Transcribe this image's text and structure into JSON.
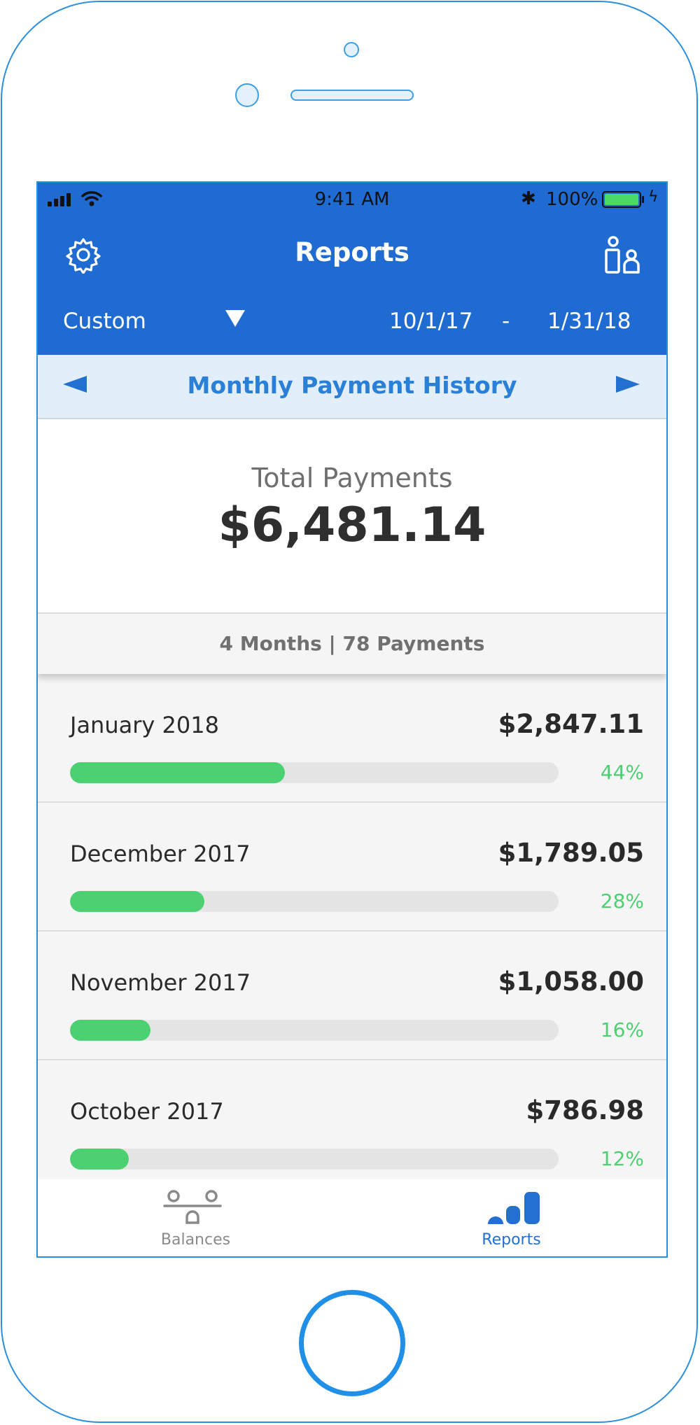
{
  "status_bar": {
    "time": "9:41 AM",
    "battery": "100%"
  },
  "header": {
    "title": "Reports",
    "settings_icon": "gear-icon",
    "profile_icon": "people-icon"
  },
  "date_range": {
    "preset": "Custom",
    "start": "10/1/17",
    "separator": "-",
    "end": "1/31/18"
  },
  "report_nav": {
    "title": "Monthly Payment History"
  },
  "summary": {
    "label": "Total Payments",
    "amount": "$6,481.14",
    "counts": "4 Months | 78 Payments"
  },
  "months": [
    {
      "name": "January 2018",
      "amount": "$2,847.11",
      "percent": "44%",
      "fraction": 0.44
    },
    {
      "name": "December 2017",
      "amount": "$1,789.05",
      "percent": "28%",
      "fraction": 0.275
    },
    {
      "name": "November 2017",
      "amount": "$1,058.00",
      "percent": "16%",
      "fraction": 0.165
    },
    {
      "name": "October 2017",
      "amount": "$786.98",
      "percent": "12%",
      "fraction": 0.12
    }
  ],
  "tabs": [
    {
      "label": "Balances",
      "icon": "balance-scale-icon",
      "active": false
    },
    {
      "label": "Reports",
      "icon": "bar-chart-icon",
      "active": true
    }
  ],
  "colors": {
    "primary": "#1f6bd2",
    "accent": "#2a7fd6",
    "progress": "#4cd071",
    "track": "#e5e5e5"
  }
}
